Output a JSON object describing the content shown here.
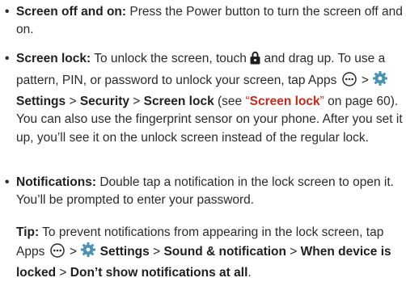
{
  "bullet_char": "•",
  "screen_off_on": {
    "heading": "Screen off and on:",
    "text": " Press the Power button to turn the screen off and on."
  },
  "screen_lock": {
    "heading": "Screen lock:",
    "t1": " To unlock the screen, touch ",
    "t2": " and drag up. To use a pattern, PIN, or password to unlock your screen, tap Apps ",
    "t3": " > ",
    "settings": "Settings",
    "gt1": " > ",
    "security": "Security",
    "gt2": " > ",
    "screen_lock_label": "Screen lock",
    "see_open": " (see ",
    "ref_label": "Screen lock",
    "ref_tail": " on page 60). You can also use the fingerprint sensor on your phone. After you set it up, you’ll see it on the unlock screen instead of the regular lock.",
    "quote_open": "“",
    "quote_close": "”"
  },
  "notifications": {
    "heading": "Notifications:",
    "text": " Double tap a notification in the lock screen to open it. You’ll be prompted to enter your password."
  },
  "tip": {
    "label": "Tip:",
    "t1": " To prevent notifications from appearing in the lock screen, tap Apps ",
    "t2": " > ",
    "settings": "Settings",
    "gt1": " > ",
    "sound_notification": "Sound & notification",
    "gt2": " > ",
    "when_locked": "When device is locked",
    "gt3": " > ",
    "dont_show": "Don’t show notifications at all",
    "end": "."
  },
  "icons": {
    "lock": "lock-icon",
    "apps": "apps-icon",
    "settings": "gear-icon"
  },
  "colors": {
    "text": "#2b2b2b",
    "link_red": "#c42a1a"
  }
}
